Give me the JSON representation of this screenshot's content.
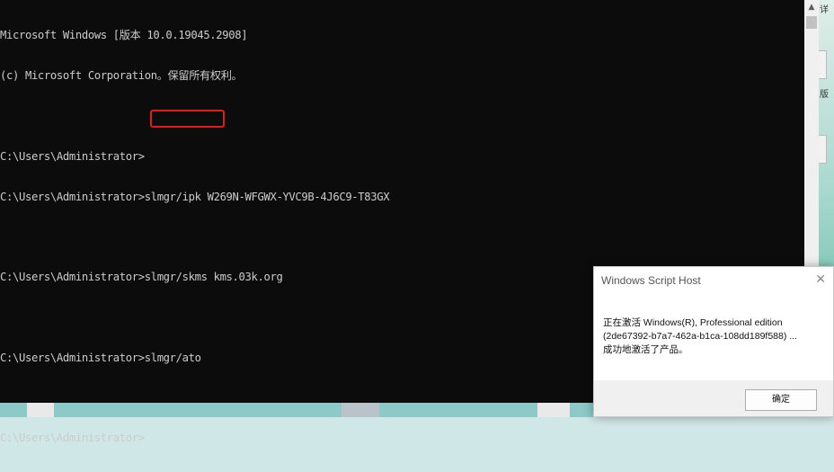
{
  "console": {
    "lines": [
      "Microsoft Windows [版本 10.0.19045.2908]",
      "(c) Microsoft Corporation。保留所有权利。",
      "",
      "C:\\Users\\Administrator>",
      "C:\\Users\\Administrator>slmgr/ipk W269N-WFGWX-YVC9B-4J6C9-T83GX",
      "",
      "C:\\Users\\Administrator>slmgr/skms kms.03k.org",
      "",
      "C:\\Users\\Administrator>slmgr/ato",
      "",
      "C:\\Users\\Administrator>"
    ]
  },
  "desktop": {
    "fragment_top": "详",
    "fragment_mid": "版"
  },
  "dialog": {
    "title": "Windows Script Host",
    "close_glyph": "✕",
    "message_line1": "正在激活 Windows(R), Professional edition",
    "message_line2": "(2de67392-b7a7-462a-b1ca-108dd189f588) ...",
    "message_line3": "成功地激活了产品。",
    "ok_label": "确定"
  },
  "scrollbar": {
    "up_glyph": "▲"
  },
  "colors": {
    "console_bg": "#0c0c0c",
    "console_fg": "#cccccc",
    "highlight": "#e01d1d"
  }
}
